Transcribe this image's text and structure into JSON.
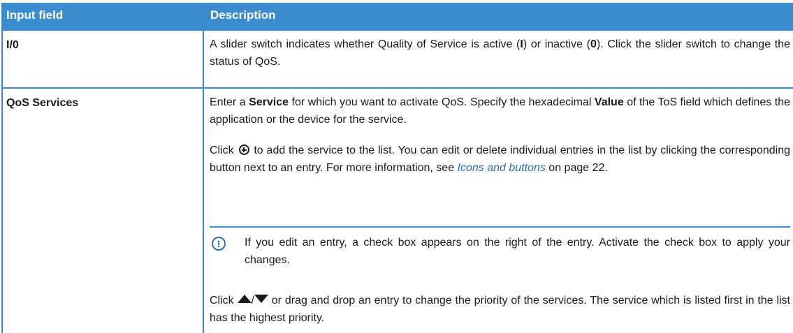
{
  "table": {
    "header": {
      "col1": "Input field",
      "col2": "Description"
    },
    "rows": [
      {
        "label": "I/0",
        "desc": {
          "t1": "A slider switch indicates whether Quality of Service is active (",
          "b1": "I",
          "t2": ") or inactive (",
          "b2": "0",
          "t3": "). Click the slider switch to change the status of QoS."
        }
      },
      {
        "label": "QoS Services",
        "p1": {
          "t1": "Enter a ",
          "b1": "Service",
          "t2": " for which you want to activate QoS. Specify the hexadecimal ",
          "b2": "Value",
          "t3": " of the ToS field which defines the application or the device for the service."
        },
        "p2": {
          "t1": "Click ",
          "t2": " to add the service to the list. You can edit or delete individual entries in the list by clicking the corresponding button next to an entry. For more information, see ",
          "link": "Icons and buttons",
          "t3": " on page 22."
        },
        "note": {
          "icon": "info-icon",
          "text": "If you edit an entry, a check box appears on the right of the entry. Activate the check box to apply your changes."
        },
        "p3": {
          "t1": "Click ",
          "sep": "/",
          "t2": " or drag and drop an entry to change the priority of the services. The service which is listed first in the list has the highest priority."
        }
      }
    ]
  },
  "colors": {
    "header_bg": "#3a8ccf",
    "link": "#2f6fb7"
  }
}
